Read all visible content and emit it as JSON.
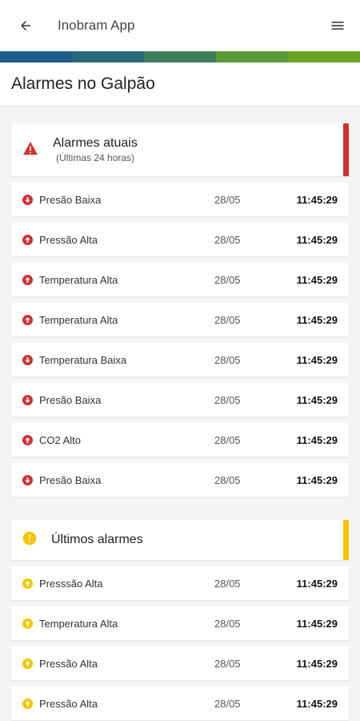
{
  "appbar": {
    "title": "Inobram App",
    "back_icon": "arrow-left-icon",
    "menu_icon": "hamburger-menu-icon"
  },
  "stripe_colors": [
    "#1e5e8c",
    "#2a6a78",
    "#3b7f5a",
    "#5a9a36",
    "#6aa623"
  ],
  "page": {
    "title": "Alarmes no Galpão"
  },
  "colors": {
    "alarm_red": "#d32f2f",
    "alarm_yellow": "#f5c400"
  },
  "current_alarms": {
    "title": "Alarmes atuais",
    "subtitle": "(Últimas 24 horas)",
    "icon": "warning-triangle-icon",
    "items": [
      {
        "name": "Presão Baixa",
        "date": "28/05",
        "time": "11:45:29",
        "dir": "down"
      },
      {
        "name": "Pressão Alta",
        "date": "28/05",
        "time": "11:45:29",
        "dir": "up"
      },
      {
        "name": "Temperatura Alta",
        "date": "28/05",
        "time": "11:45:29",
        "dir": "up"
      },
      {
        "name": "Temperatura Alta",
        "date": "28/05",
        "time": "11:45:29",
        "dir": "up"
      },
      {
        "name": "Temperatura Baixa",
        "date": "28/05",
        "time": "11:45:29",
        "dir": "down"
      },
      {
        "name": "Presão Baixa",
        "date": "28/05",
        "time": "11:45:29",
        "dir": "down"
      },
      {
        "name": "CO2 Alto",
        "date": "28/05",
        "time": "11:45:29",
        "dir": "up"
      },
      {
        "name": "Presão Baixa",
        "date": "28/05",
        "time": "11:45:29",
        "dir": "down"
      }
    ]
  },
  "recent_alarms": {
    "title": "Últimos alarmes",
    "icon": "exclamation-circle-icon",
    "items": [
      {
        "name": "Presssão Alta",
        "date": "28/05",
        "time": "11:45:29",
        "dir": "up"
      },
      {
        "name": "Temperatura Alta",
        "date": "28/05",
        "time": "11:45:29",
        "dir": "up"
      },
      {
        "name": "Pressão Alta",
        "date": "28/05",
        "time": "11:45:29",
        "dir": "up"
      },
      {
        "name": "Pressão Alta",
        "date": "28/05",
        "time": "11:45:29",
        "dir": "up"
      }
    ]
  }
}
